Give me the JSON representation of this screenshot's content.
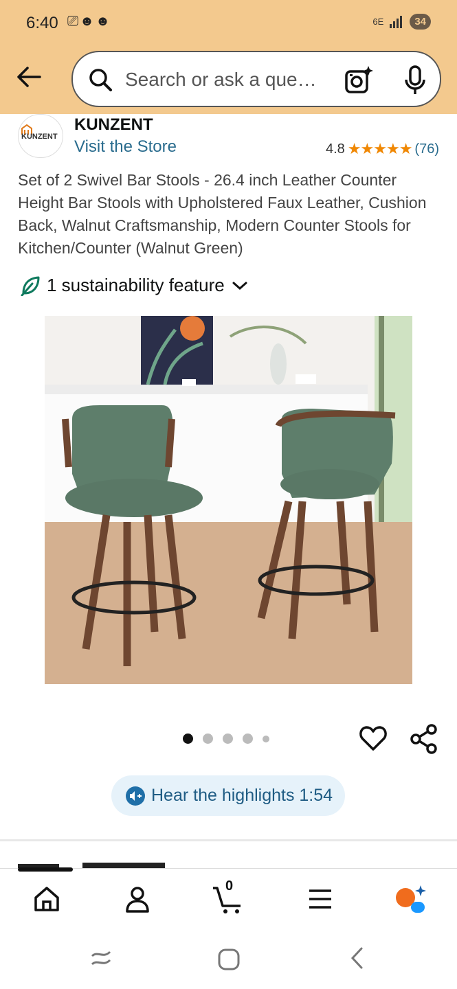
{
  "status_bar": {
    "time": "6:40",
    "left_icons": "⎚☻☻",
    "network": "6E",
    "battery": "34"
  },
  "search": {
    "placeholder": "Search or ask a que…"
  },
  "brand": {
    "logo_text": "KUNZENT",
    "name": "KUNZENT",
    "visit_store": "Visit the Store",
    "rating": "4.8",
    "stars": "★★★★★",
    "review_count": "(76)"
  },
  "product": {
    "title": "Set of 2 Swivel Bar Stools - 26.4 inch Leather Counter Height Bar Stools with Upholstered Faux Leather, Cushion Back, Walnut Craftsmanship, Modern Counter Stools for Kitchen/Counter (Walnut Green)",
    "sustainability": "1 sustainability feature",
    "image_count": 5,
    "active_image": 1
  },
  "actions": {
    "hear_highlights": "Hear the highlights 1:54"
  },
  "bottom_nav": {
    "cart_count": "0",
    "items": [
      "home-icon",
      "account-icon",
      "cart-icon",
      "menu-icon",
      "rufus-icon"
    ]
  },
  "colors": {
    "header_bg": "#f3c98e",
    "link": "#2a6c8e",
    "stars": "#f08804",
    "highlight_bg": "#e6f2fa",
    "highlight_text": "#1f5c84",
    "leaf": "#0f7a5e"
  }
}
